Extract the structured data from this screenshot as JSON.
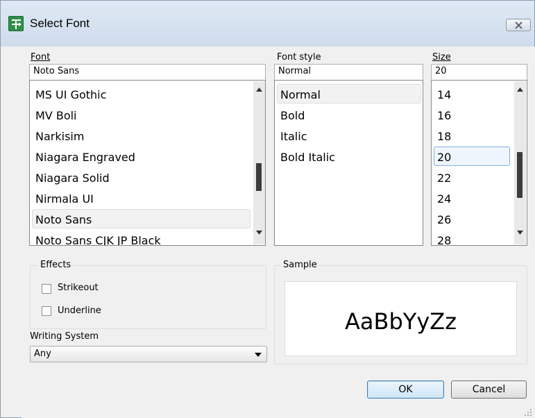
{
  "window": {
    "title": "Select Font",
    "app_icon": "font-dialog-icon",
    "close_icon": "close-icon"
  },
  "font": {
    "label": "Font",
    "value": "Noto Sans",
    "items": [
      "MS UI Gothic",
      "MV Boli",
      "Narkisim",
      "Niagara Engraved",
      "Niagara Solid",
      "Nirmala UI",
      "Noto Sans",
      "Noto Sans CJK JP Black"
    ],
    "selected": "Noto Sans",
    "scroll_position": 0.72
  },
  "font_style": {
    "label": "Font style",
    "value": "Normal",
    "items": [
      "Normal",
      "Bold",
      "Italic",
      "Bold Italic"
    ],
    "selected": "Normal"
  },
  "size": {
    "label": "Size",
    "value": "20",
    "items": [
      "14",
      "16",
      "18",
      "20",
      "22",
      "24",
      "26",
      "28"
    ],
    "selected": "20",
    "scroll_position": 0.55
  },
  "effects": {
    "label": "Effects",
    "strikeout_label": "Strikeout",
    "strikeout_checked": false,
    "underline_label": "Underline",
    "underline_checked": false
  },
  "writing_system": {
    "label": "Writing System",
    "value": "Any"
  },
  "sample": {
    "label": "Sample",
    "text": "AaBbYyZz"
  },
  "buttons": {
    "ok": "OK",
    "cancel": "Cancel"
  },
  "colors": {
    "titlebar": "#d6e2f0",
    "selection_border": "#84acdd",
    "default_button_border": "#3c7fb1"
  }
}
